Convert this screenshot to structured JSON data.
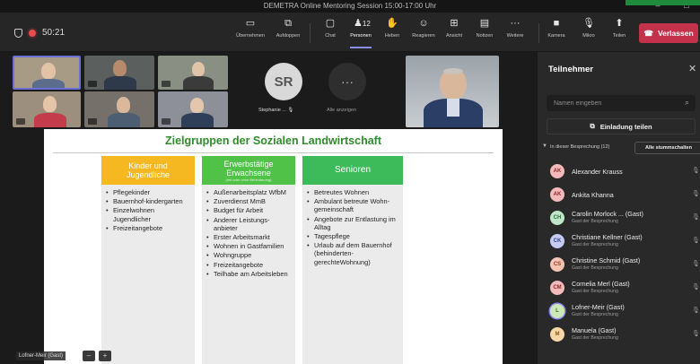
{
  "window": {
    "title": "DEMETRA Online Mentoring Session 15:00-17:00 Uhr"
  },
  "toolbar": {
    "timer": "50:21",
    "buttons": [
      {
        "label": "Übernehmen",
        "icon": "share-screen-icon"
      },
      {
        "label": "Aufdoppen",
        "icon": "pop-out-icon"
      },
      {
        "label": "Chat",
        "icon": "chat-icon"
      },
      {
        "label": "Personen",
        "icon": "people-icon",
        "count": "12"
      },
      {
        "label": "Heben",
        "icon": "raise-hand-icon"
      },
      {
        "label": "Reagieren",
        "icon": "reaction-icon"
      },
      {
        "label": "Ansicht",
        "icon": "view-icon"
      },
      {
        "label": "Notizen",
        "icon": "notes-icon"
      },
      {
        "label": "Weitere",
        "icon": "more-icon"
      },
      {
        "label": "Kamera",
        "icon": "camera-icon"
      },
      {
        "label": "Mikro",
        "icon": "mic-off-icon"
      },
      {
        "label": "Teilen",
        "icon": "share-icon"
      }
    ],
    "leave_label": "Verlassen"
  },
  "stage": {
    "avatar_initials": "SR",
    "avatar_name": "Stephanie ...",
    "more_label": "Alle anzeigen",
    "self_label": "Lofner-Meir (Gast)"
  },
  "slide": {
    "title": "Zielgruppen der Sozialen Landwirtschaft",
    "columns": [
      {
        "header_line1": "Kinder und",
        "header_line2": "Jugendliche",
        "header_sub": "",
        "color": "#f5b820",
        "items": [
          "Pflegekinder",
          "Bauernhof-kindergarten",
          "Einzelwohnen Jugendlicher",
          "Freizeitangebote"
        ]
      },
      {
        "header_line1": "Erwerbstätige",
        "header_line2": "Erwachsene",
        "header_sub": "(mit oder ohne Behinderung)",
        "color": "#4fc247",
        "items": [
          "Außenarbeitsplatz WfbM",
          "Zuverdienst MmB",
          "Budget für Arbeit",
          "Anderer Leistungs-anbieter",
          "Erster Arbeitsmarkt",
          "Wohnen in Gastfamilien",
          "Wohngruppe",
          "Freizeitangebote",
          "Teilhabe am Arbeitsleben"
        ]
      },
      {
        "header_line1": "Senioren",
        "header_line2": "",
        "header_sub": "",
        "color": "#3dbb5a",
        "items": [
          "Betreutes Wohnen",
          "Ambulant betreute Wohn-gemeinschaft",
          "Angebote zur Entlastung im Alltag",
          "Tagespflege",
          "Urlaub auf dem Bauernhof (behinderten-gerechteWohnung)"
        ]
      }
    ]
  },
  "panel": {
    "title": "Teilnehmer",
    "search_placeholder": "Namen eingeben",
    "invite_label": "Einladung teilen",
    "section_label": "In dieser Besprechung (12)",
    "mute_all_label": "Alle stummschalten",
    "participants": [
      {
        "initials": "AK",
        "name": "Alexander Krauss",
        "sub": "",
        "color": "#f4b9b9",
        "text_color": "#8a2a2a"
      },
      {
        "initials": "AK",
        "name": "Ankita Khanna",
        "sub": "",
        "color": "#f4b9b9",
        "text_color": "#8a2a2a"
      },
      {
        "initials": "CH",
        "name": "Carolin Morlock ... (Gast)",
        "sub": "Gast der Besprechung",
        "color": "#bfe6c8",
        "text_color": "#2e6b3e"
      },
      {
        "initials": "CK",
        "name": "Christiane Kellner (Gast)",
        "sub": "Gast der Besprechung",
        "color": "#c5cbf2",
        "text_color": "#3a4390"
      },
      {
        "initials": "CS",
        "name": "Christine Schmid (Gast)",
        "sub": "Gast der Besprechung",
        "color": "#f4c3b2",
        "text_color": "#8a3b22"
      },
      {
        "initials": "CM",
        "name": "Cornelia Merl (Gast)",
        "sub": "Gast der Besprechung",
        "color": "#f4b9b9",
        "text_color": "#8a2a2a"
      },
      {
        "initials": "L",
        "name": "Lofner-Meir (Gast)",
        "sub": "Gast der Besprechung",
        "color": "#cfe8b8",
        "text_color": "#4a6b2a"
      },
      {
        "initials": "M",
        "name": "Manuela (Gast)",
        "sub": "Gast der Besprechung",
        "color": "#f7d7a8",
        "text_color": "#8a5a1a"
      }
    ]
  }
}
